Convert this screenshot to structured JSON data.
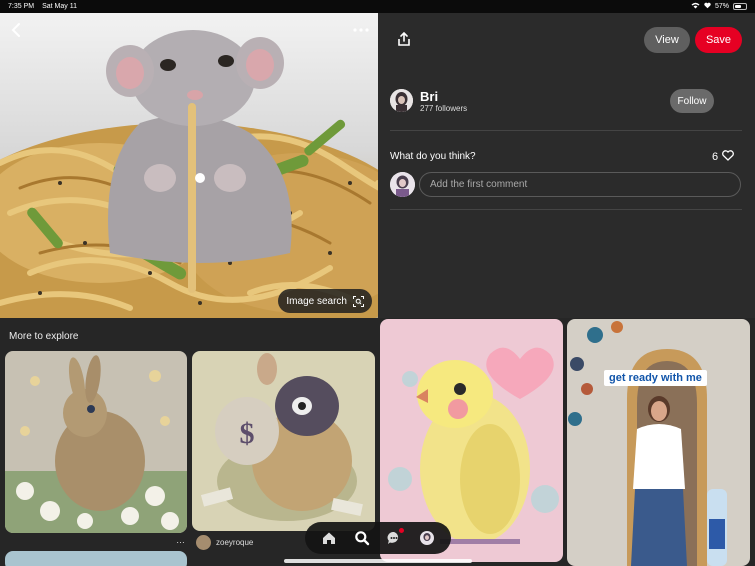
{
  "status_bar": {
    "time": "7:35 PM",
    "date": "Sat May 11",
    "battery": "57%",
    "battery_level": 0.57
  },
  "hero": {
    "image_search_label": "Image search",
    "icons": {
      "back": "chevron-left-icon",
      "more": "more-horizontal-icon",
      "image_search": "visual-search-icon"
    }
  },
  "panel": {
    "view_label": "View",
    "save_label": "Save",
    "creator": {
      "name": "Bri",
      "followers": "277 followers"
    },
    "follow_label": "Follow",
    "question": "What do you think?",
    "like_count": "6",
    "comment_placeholder": "Add the first comment"
  },
  "explore": {
    "title": "More to explore",
    "pin_user": "zoeyroque",
    "more_dots": "…"
  },
  "promo": {
    "label": "get ready with me"
  },
  "colors": {
    "save": "#e60023",
    "panel_bg": "#2b2b2b",
    "button_gray": "#5f5f5f"
  },
  "tabbar": {
    "icons": [
      "home-icon",
      "search-icon",
      "messages-icon",
      "profile-icon"
    ]
  }
}
